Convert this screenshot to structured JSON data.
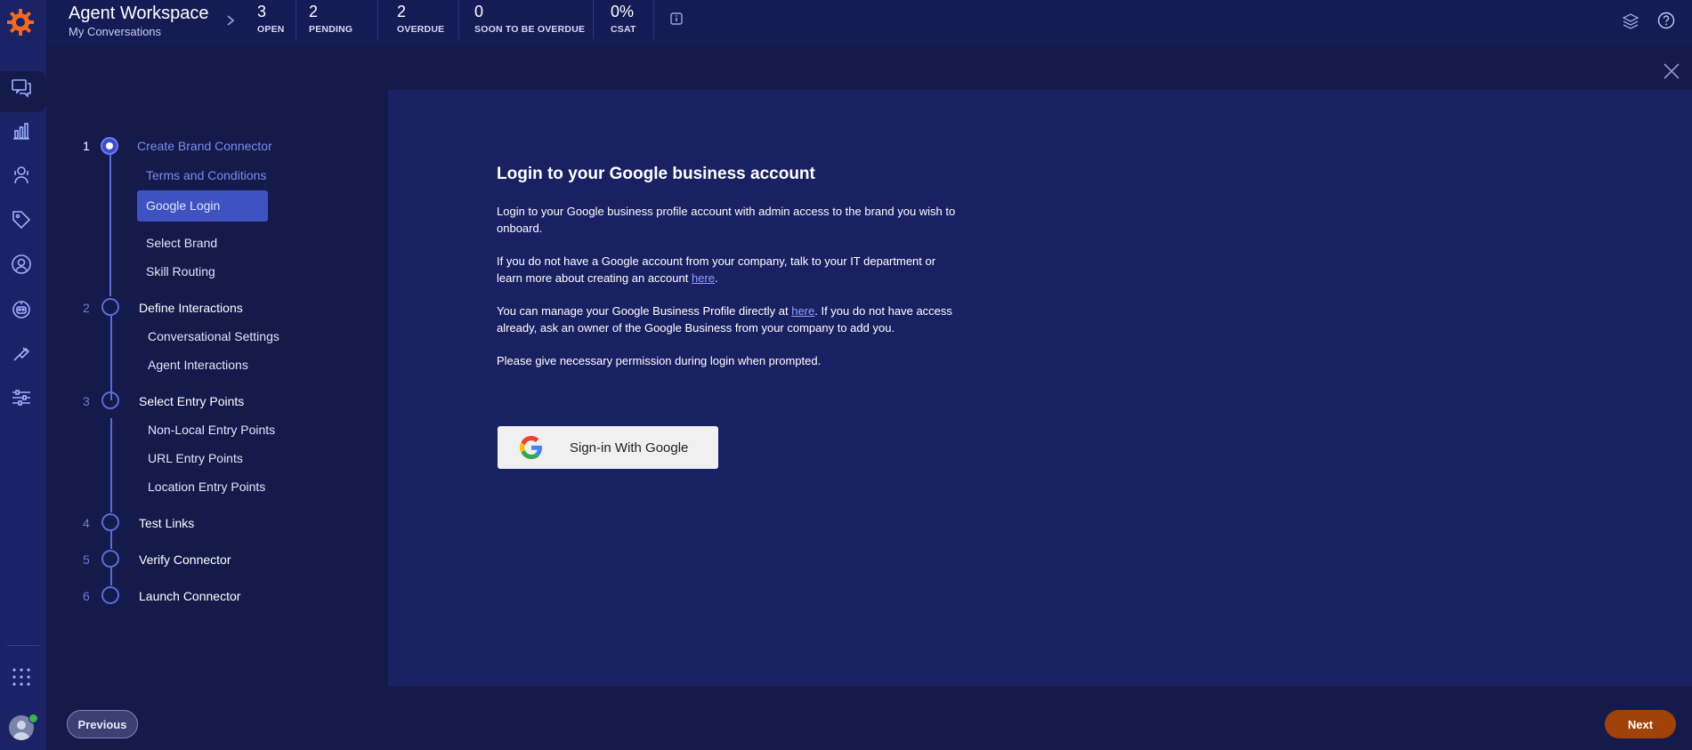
{
  "header": {
    "title": "Agent Workspace",
    "subtitle": "My Conversations",
    "stats": [
      {
        "value": "3",
        "label": "OPEN"
      },
      {
        "value": "2",
        "label": "PENDING"
      },
      {
        "value": "2",
        "label": "OVERDUE"
      },
      {
        "value": "0",
        "label": "SOON TO BE OVERDUE"
      },
      {
        "value": "0%",
        "label": "CSAT"
      }
    ]
  },
  "rail": {
    "icons": [
      "conversations-icon",
      "reports-icon",
      "agent-icon",
      "tags-icon",
      "contacts-icon",
      "bot-icon",
      "automation-icon",
      "settings-sliders-icon",
      "apps-grid-icon"
    ]
  },
  "steps": [
    {
      "num": "1",
      "label": "Create Brand Connector",
      "subs": [
        "Terms and Conditions",
        "Google Login",
        "Select Brand",
        "Skill Routing"
      ]
    },
    {
      "num": "2",
      "label": "Define Interactions",
      "subs": [
        "Conversational Settings",
        "Agent Interactions"
      ]
    },
    {
      "num": "3",
      "label": "Select Entry Points",
      "subs": [
        "Non-Local Entry Points",
        "URL Entry Points",
        "Location Entry Points"
      ]
    },
    {
      "num": "4",
      "label": "Test Links"
    },
    {
      "num": "5",
      "label": "Verify Connector"
    },
    {
      "num": "6",
      "label": "Launch Connector"
    }
  ],
  "content": {
    "title": "Login to your Google business account",
    "p1": "Login to your Google business profile account with admin access to the brand you wish to onboard.",
    "p2_pre": "If you do not have a Google account from your company, talk to your IT department or learn more about creating an account ",
    "p2_link": "here",
    "p2_post": ".",
    "p3_pre": "You can manage your Google Business Profile directly at ",
    "p3_link": "here",
    "p3_post": ". If you do not have access already, ask an owner of the Google Business from your company to add you.",
    "p4": "Please give necessary permission during login when prompted.",
    "signin_label": "Sign-in With Google"
  },
  "footer": {
    "previous_label": "Previous",
    "next_label": "Next"
  },
  "colors": {
    "accent": "#3e52c2",
    "next_button": "#a0420a",
    "background": "#141a4a"
  }
}
